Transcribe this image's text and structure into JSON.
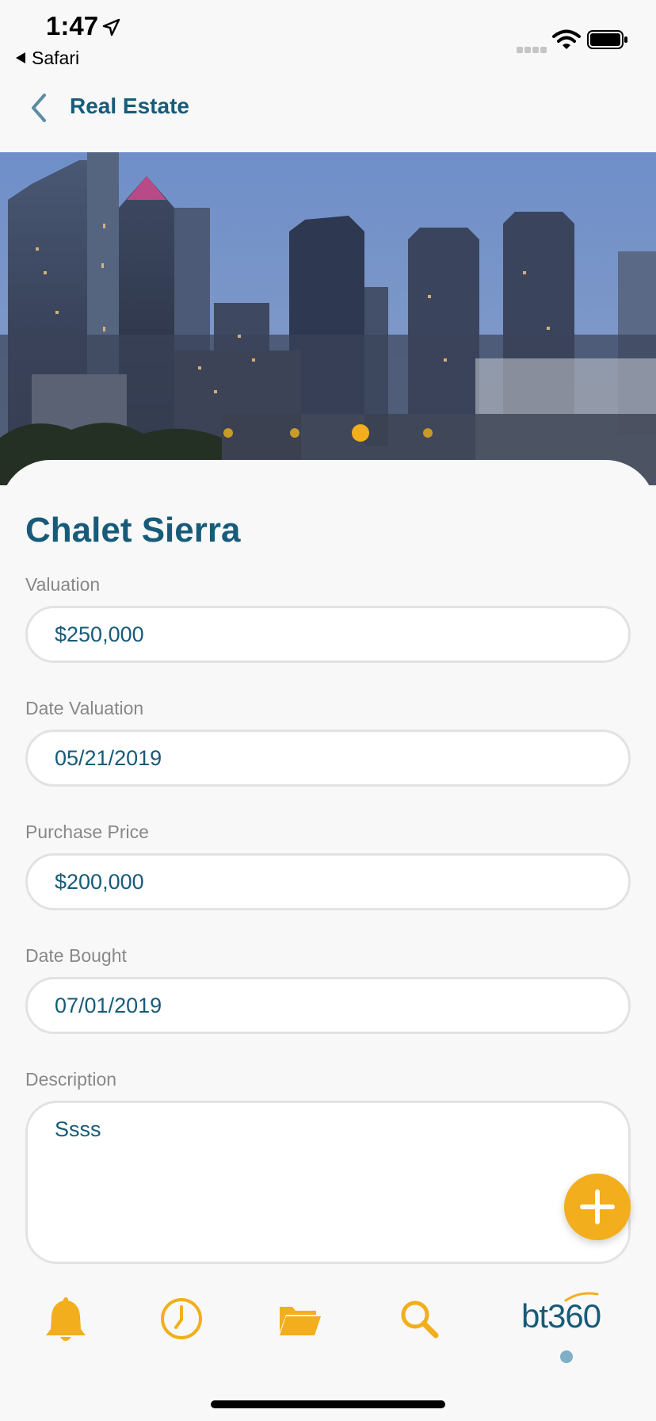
{
  "status_bar": {
    "time": "1:47",
    "back_app": "Safari"
  },
  "nav": {
    "title": "Real Estate"
  },
  "carousel": {
    "page_count": 4,
    "active_index": 2
  },
  "property": {
    "name": "Chalet Sierra",
    "fields": [
      {
        "label": "Valuation",
        "value": "$250,000"
      },
      {
        "label": "Date Valuation",
        "value": "05/21/2019"
      },
      {
        "label": "Purchase Price",
        "value": "$200,000"
      },
      {
        "label": "Date Bought",
        "value": "07/01/2019"
      }
    ],
    "description": {
      "label": "Description",
      "value": "Ssss"
    }
  },
  "tab_bar": {
    "items": [
      {
        "icon": "bell-icon"
      },
      {
        "icon": "clock-icon"
      },
      {
        "icon": "folder-icon"
      },
      {
        "icon": "search-icon"
      }
    ],
    "brand": "bt360"
  },
  "colors": {
    "brand_blue": "#175b79",
    "accent_yellow": "#f2ae1c",
    "label_gray": "#888888"
  }
}
